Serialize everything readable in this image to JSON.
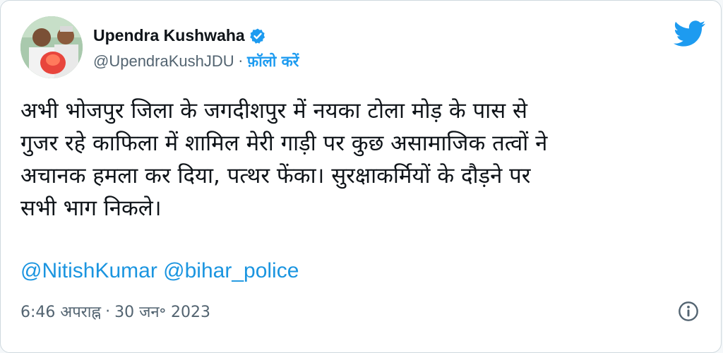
{
  "tweet": {
    "author_name": "Upendra Kushwaha",
    "handle": "@UpendraKushJDU",
    "separator": "·",
    "follow_label": "फ़ॉलो करें",
    "text_lines": [
      "अभी भोजपुर जिला के जगदीशपुर में नयका टोला मोड़ के पास से",
      "गुजर रहे काफिला में शामिल मेरी गाड़ी पर कुछ असामाजिक तत्वों ने",
      "अचानक हमला कर दिया, पत्थर फेंका। सुरक्षाकर्मियों के दौड़ने पर",
      "सभी भाग निकले।"
    ],
    "mentions": [
      "@NitishKumar",
      "@bihar_police"
    ],
    "time": "6:46 अपराह्न",
    "date": "30 जन॰ 2023"
  },
  "icons": {
    "verified": "verified-badge-icon",
    "bird": "twitter-bird-icon",
    "info": "info-icon"
  },
  "colors": {
    "accent": "#1d9bf0",
    "text": "#0f1419",
    "muted": "#536471",
    "mention": "#1b95e0"
  }
}
